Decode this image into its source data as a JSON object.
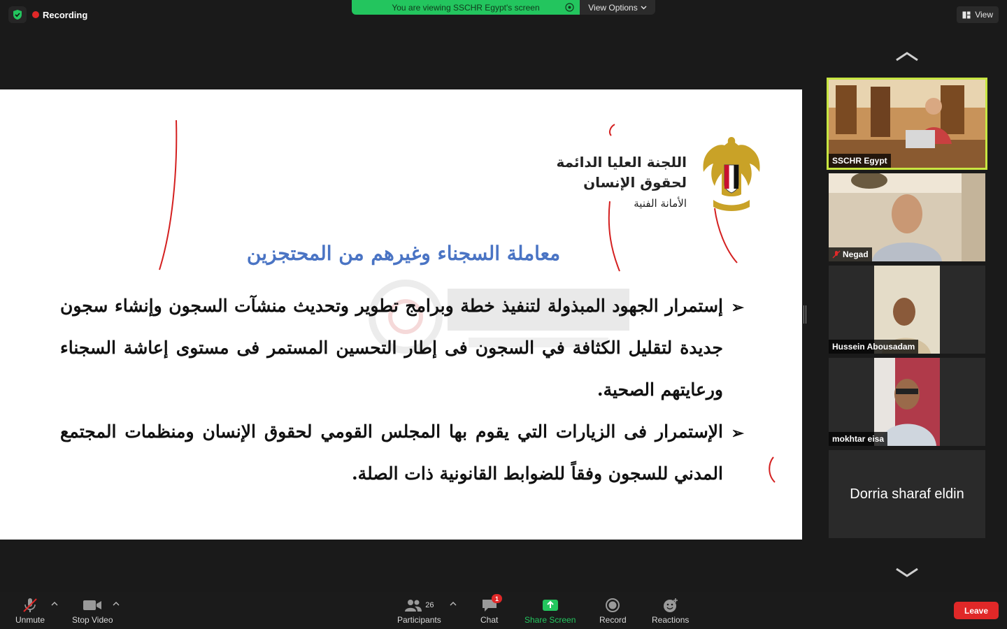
{
  "top_bar": {
    "recording_label": "Recording",
    "viewing_text": "You are viewing SSCHR Egypt's screen",
    "view_options_label": "View Options",
    "view_label": "View"
  },
  "slide": {
    "org_name_line1": "اللجنة العليا الدائمة",
    "org_name_line2": "لحقوق الإنسان",
    "org_name_line3": "الأمانة الفنية",
    "heading": "معاملة السجناء وغيرهم من المحتجزين",
    "bullets": [
      "إستمرار الجهود المبذولة لتنفيذ خطة وبرامج تطوير وتحديث منشآت السجون وإنشاء سجون جديدة لتقليل الكثافة في السجون فى إطار التحسين المستمر فى مستوى إعاشة السجناء ورعايتهم الصحية.",
      "الإستمرار فى الزيارات التي يقوم بها المجلس القومي لحقوق الإنسان ومنظمات المجتمع المدني للسجون وفقاً للضوابط القانونية ذات الصلة."
    ],
    "bullet_marker": "➢"
  },
  "participants": [
    {
      "name": "SSCHR Egypt",
      "active": true,
      "muted": false
    },
    {
      "name": "Negad",
      "active": false,
      "muted": true
    },
    {
      "name": "Hussein Abousadam",
      "active": false,
      "muted": false
    },
    {
      "name": "mokhtar eisa",
      "active": false,
      "muted": false
    },
    {
      "name": "Dorria sharaf eldin",
      "active": false,
      "muted": false,
      "video_off": true
    }
  ],
  "toolbar": {
    "unmute_label": "Unmute",
    "stop_video_label": "Stop Video",
    "participants_label": "Participants",
    "participants_count": "26",
    "chat_label": "Chat",
    "chat_badge": "1",
    "share_screen_label": "Share Screen",
    "record_label": "Record",
    "reactions_label": "Reactions",
    "leave_label": "Leave"
  },
  "colors": {
    "accent_green": "#23c55e",
    "leave_red": "#e02828",
    "active_speaker": "#c8e641",
    "heading_blue": "#4a74c4"
  }
}
